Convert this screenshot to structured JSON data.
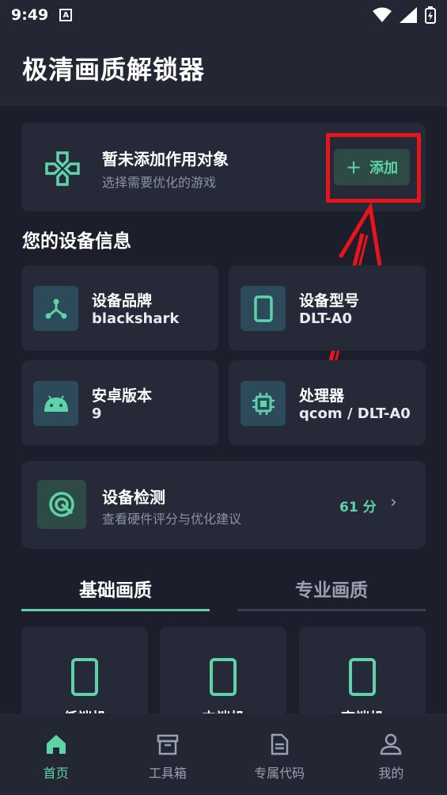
{
  "status_bar": {
    "time": "9:49",
    "notif_glyph": "A"
  },
  "header": {
    "title": "极清画质解锁器"
  },
  "target": {
    "title": "暂未添加作用对象",
    "subtitle": "选择需要优化的游戏",
    "add_button": {
      "plus": "+",
      "label": "添加"
    }
  },
  "device_section": {
    "title": "您的设备信息"
  },
  "device_info": [
    {
      "label": "设备品牌",
      "value": "blackshark",
      "icon": "share-hub-icon"
    },
    {
      "label": "设备型号",
      "value": "DLT-A0",
      "icon": "phone-icon"
    },
    {
      "label": "安卓版本",
      "value": "9",
      "icon": "android-icon"
    },
    {
      "label": "处理器",
      "value": "qcom / DLT-A0",
      "icon": "chip-icon"
    }
  ],
  "detection": {
    "title": "设备检测",
    "subtitle": "查看硬件评分与优化建议",
    "score": "61 分",
    "chevron": "›"
  },
  "tabs": [
    {
      "label": "基础画质",
      "active": true
    },
    {
      "label": "专业画质",
      "active": false
    }
  ],
  "quality_presets": [
    {
      "label": "低端机"
    },
    {
      "label": "中端机"
    },
    {
      "label": "高端机"
    }
  ],
  "bottom_nav": [
    {
      "label": "首页",
      "icon": "home-icon",
      "active": true
    },
    {
      "label": "工具箱",
      "icon": "archive-box-icon",
      "active": false
    },
    {
      "label": "专属代码",
      "icon": "document-icon",
      "active": false
    },
    {
      "label": "我的",
      "icon": "user-icon",
      "active": false
    }
  ],
  "colors": {
    "accent": "#5fd3a8",
    "background": "#1c1f2b",
    "card": "#262a38",
    "highlight": "#e8141c"
  }
}
